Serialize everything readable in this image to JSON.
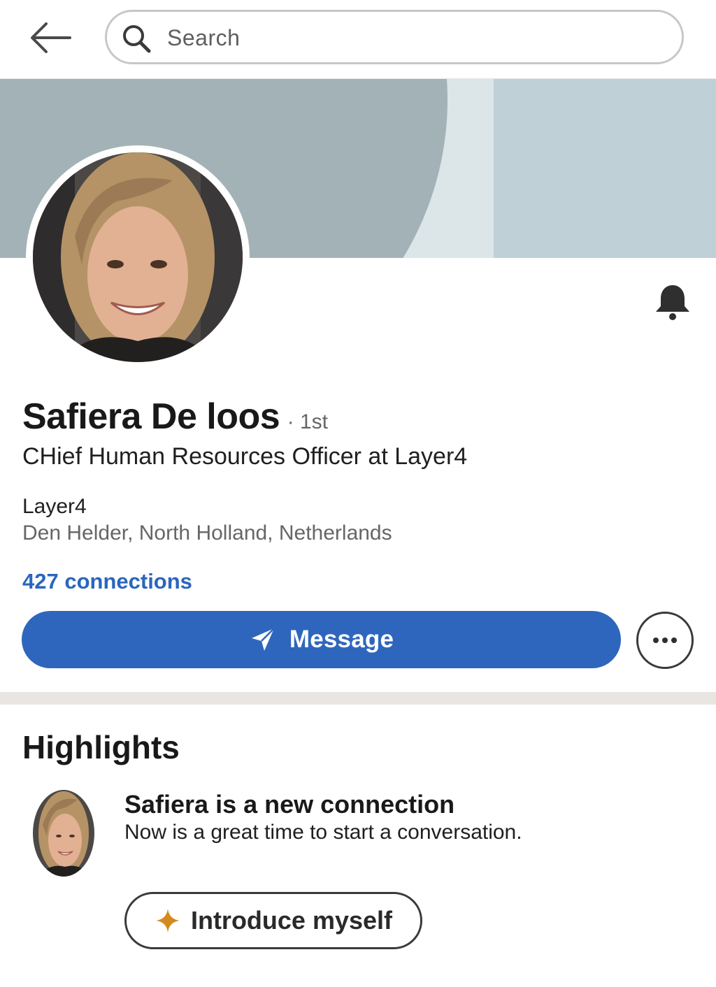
{
  "colors": {
    "accent": "#2f66bd",
    "link": "#2a66bd",
    "banner_bg": "#dce5e8",
    "banner_shape": "#a3b2b6",
    "banner_panel": "#bfd0d6",
    "sparkle": "#d48a1e"
  },
  "topbar": {
    "back_icon": "arrow-left-icon",
    "search_icon": "search-icon",
    "search_placeholder": "Search"
  },
  "profile": {
    "name": "Safiera De loos",
    "degree": "· 1st",
    "headline": "CHief Human Resources Officer at Layer4",
    "company": "Layer4",
    "location": "Den Helder, North Holland, Netherlands",
    "connections": "427 connections",
    "bell_icon": "bell-icon"
  },
  "actions": {
    "message_label": "Message",
    "message_icon": "send-icon",
    "more_icon": "ellipsis-icon"
  },
  "highlights": {
    "title": "Highlights",
    "heading": "Safiera is a new connection",
    "subtext": "Now is a great time to start a conversation.",
    "button_label": "Introduce myself",
    "button_icon": "sparkle-icon"
  }
}
